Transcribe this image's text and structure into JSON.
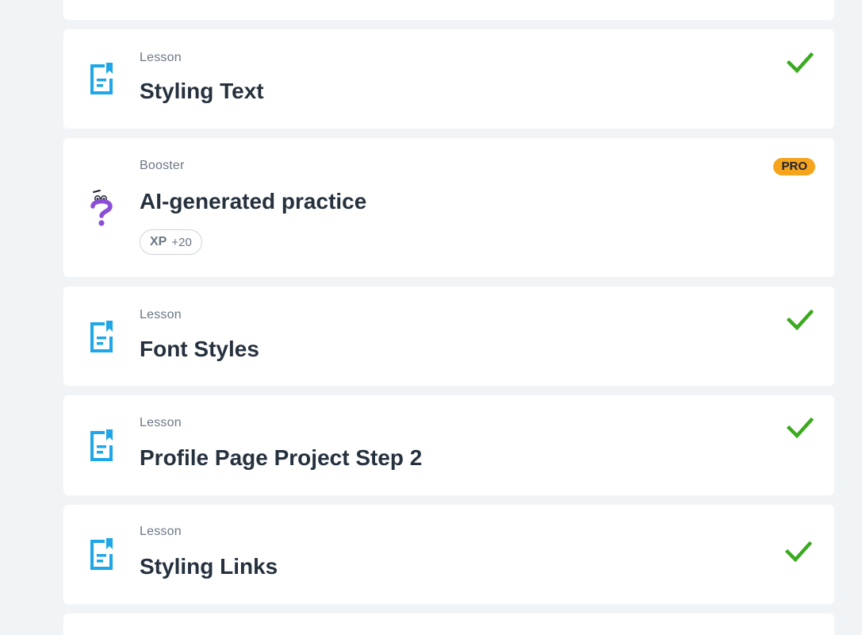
{
  "items": [
    {
      "type": "Lesson",
      "title": "Styling Text",
      "completed": true
    },
    {
      "type": "Booster",
      "title": "AI-generated practice",
      "badge": "PRO",
      "xp_label": "XP",
      "xp_value": "+20"
    },
    {
      "type": "Lesson",
      "title": "Font Styles",
      "completed": true
    },
    {
      "type": "Lesson",
      "title": "Profile Page Project Step 2",
      "completed": true
    },
    {
      "type": "Lesson",
      "title": "Styling Links",
      "completed": true
    }
  ],
  "icons": {
    "lesson": "lesson-document-icon",
    "booster": "question-mark-icon",
    "completed": "checkmark-icon"
  },
  "colors": {
    "background": "#f1f4f7",
    "card": "#ffffff",
    "lesson_icon": "#1ea7e8",
    "booster_icon": "#8a4fd6",
    "check": "#3aaa1e",
    "pro_badge": "#f7a41d",
    "title": "#26313e",
    "type": "#6b7785"
  }
}
